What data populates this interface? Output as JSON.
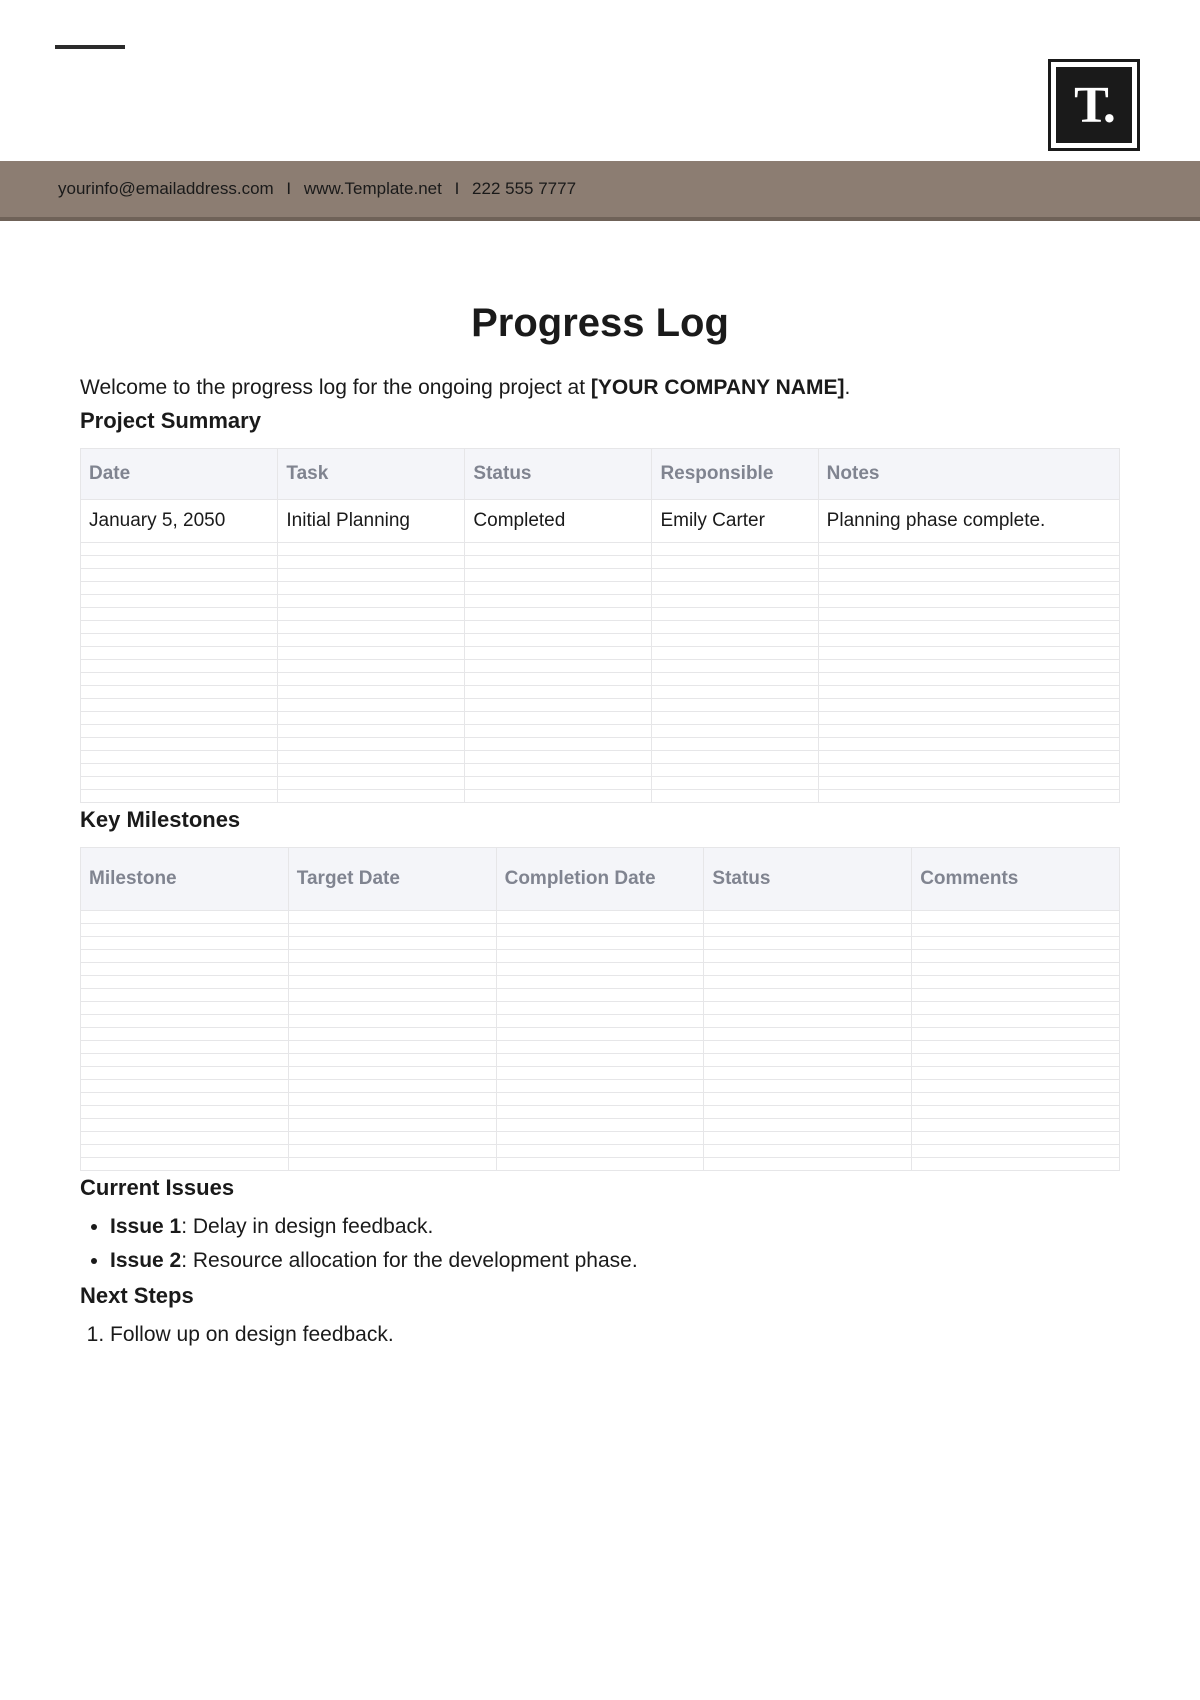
{
  "logo_text": "T.",
  "info_bar": {
    "email": "yourinfo@emailaddress.com",
    "website": "www.Template.net",
    "phone": "222 555 7777",
    "separator": "I"
  },
  "title": "Progress Log",
  "intro_prefix": "Welcome to the progress log for the ongoing project at ",
  "intro_company": "[YOUR COMPANY NAME]",
  "intro_suffix": ".",
  "sections": {
    "project_summary": "Project Summary",
    "key_milestones": "Key Milestones",
    "current_issues": "Current Issues",
    "next_steps": "Next Steps"
  },
  "summary_table": {
    "headers": [
      "Date",
      "Task",
      "Status",
      "Responsible",
      "Notes"
    ],
    "rows": [
      {
        "date": "January 5, 2050",
        "task": "Initial Planning",
        "status": "Completed",
        "responsible": "Emily Carter",
        "notes": "Planning phase complete."
      }
    ],
    "empty_row_count": 20
  },
  "milestones_table": {
    "headers": [
      "Milestone",
      "Target Date",
      "Completion Date",
      "Status",
      "Comments"
    ],
    "empty_row_count": 20
  },
  "issues": [
    {
      "label": "Issue 1",
      "text": ": Delay in design feedback."
    },
    {
      "label": "Issue 2",
      "text": ": Resource allocation for the development phase."
    }
  ],
  "next_steps": [
    "Follow up on design feedback."
  ]
}
